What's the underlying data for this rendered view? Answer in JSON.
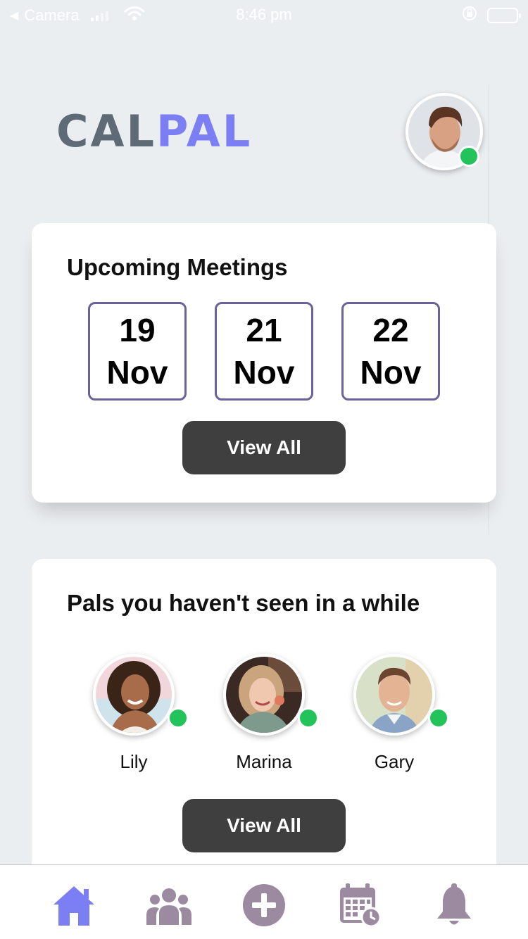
{
  "status_bar": {
    "back_label": "Camera",
    "time": "8:46 pm"
  },
  "header": {
    "logo_part1": "CAL",
    "logo_part2": "PAL",
    "profile_status": "online"
  },
  "colors": {
    "logo_gray": "#5e6b77",
    "logo_accent": "#7c7ef4",
    "online": "#22c35a",
    "date_border": "#6b629c",
    "button_bg": "#3f3f3f",
    "nav_active": "#7c7ef4",
    "nav_inactive": "#9b8aa0"
  },
  "meetings": {
    "title": "Upcoming Meetings",
    "dates": [
      {
        "day": "19",
        "month": "Nov"
      },
      {
        "day": "21",
        "month": "Nov"
      },
      {
        "day": "22",
        "month": "Nov"
      }
    ],
    "view_all_label": "View All"
  },
  "pals": {
    "title": "Pals you haven't seen in a while",
    "people": [
      {
        "name": "Lily"
      },
      {
        "name": "Marina"
      },
      {
        "name": "Gary"
      }
    ],
    "view_all_label": "View All"
  },
  "nav": {
    "items": [
      {
        "icon": "home-icon",
        "active": true
      },
      {
        "icon": "group-icon",
        "active": false
      },
      {
        "icon": "plus-circle-icon",
        "active": false
      },
      {
        "icon": "calendar-icon",
        "active": false
      },
      {
        "icon": "bell-icon",
        "active": false
      }
    ]
  }
}
